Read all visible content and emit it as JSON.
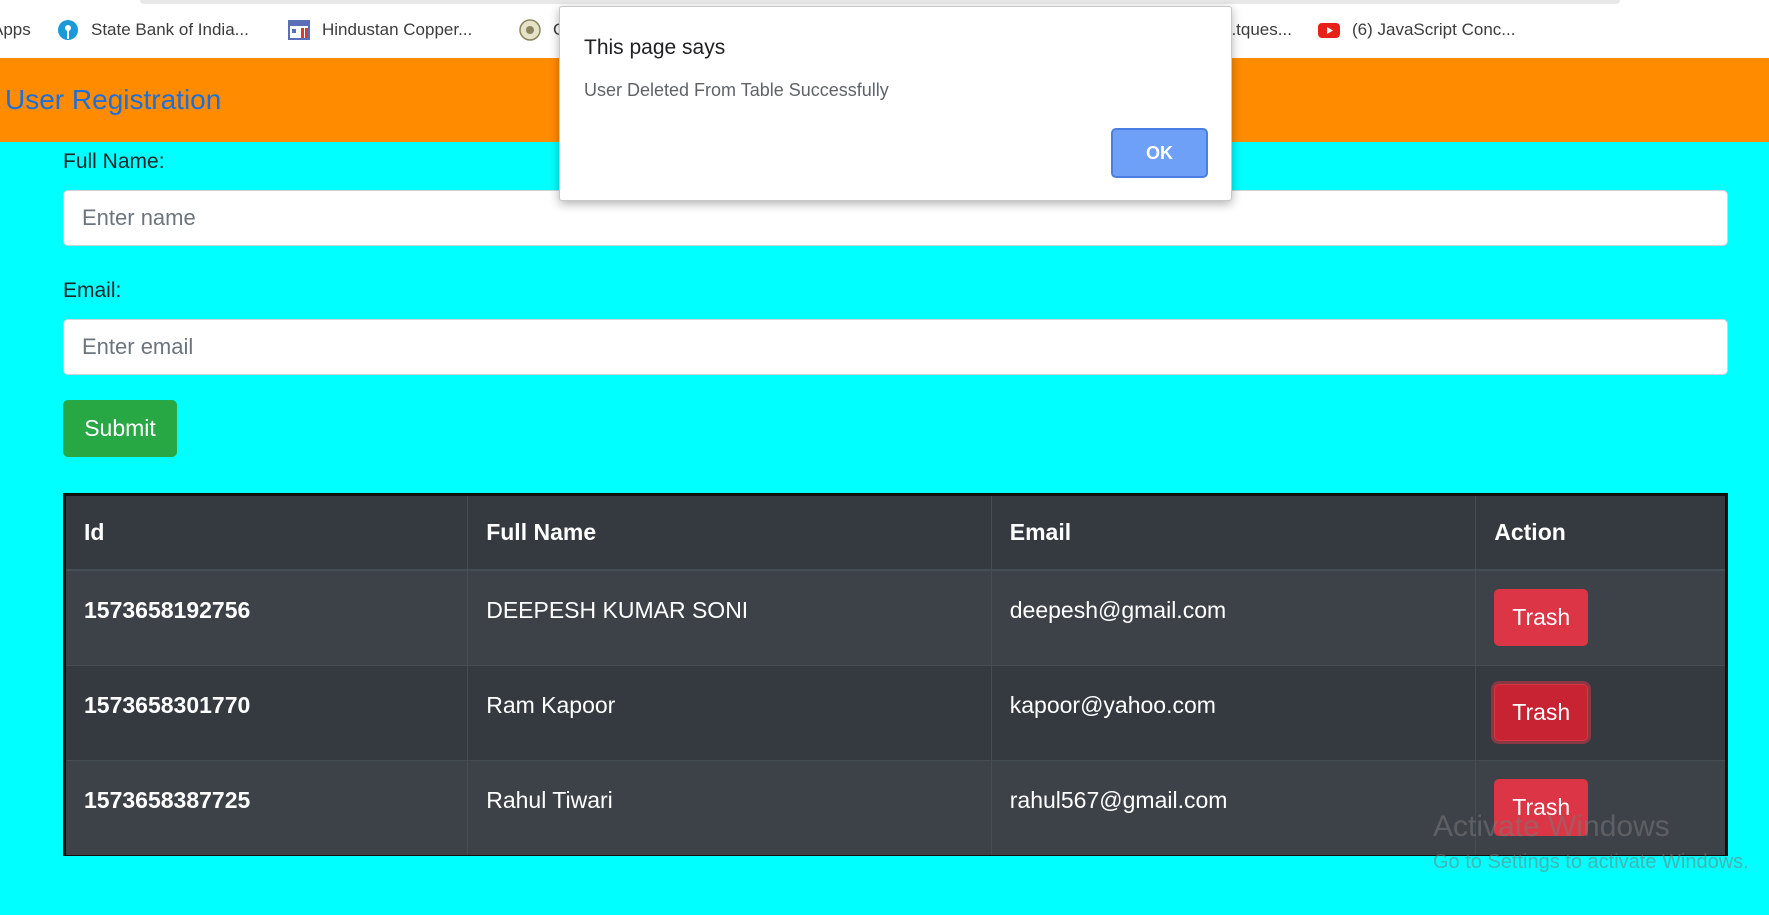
{
  "bookmarks": [
    {
      "label": "Apps",
      "icon": "apps-icon"
    },
    {
      "label": "State Bank of India...",
      "icon": "sbi-icon"
    },
    {
      "label": "Hindustan Copper...",
      "icon": "hindustan-copper-icon"
    },
    {
      "label": "G",
      "icon": "emblem-icon"
    },
    {
      "label": "...tques...",
      "icon": ""
    },
    {
      "label": "(6) JavaScript Conc...",
      "icon": "youtube-icon"
    }
  ],
  "header": {
    "title": "User Registration"
  },
  "form": {
    "name_label": "Full Name:",
    "name_placeholder": "Enter name",
    "email_label": "Email:",
    "email_placeholder": "Enter email",
    "submit_label": "Submit"
  },
  "table": {
    "headers": [
      "Id",
      "Full Name",
      "Email",
      "Action"
    ],
    "rows": [
      {
        "id": "1573658192756",
        "name": "DEEPESH KUMAR SONI",
        "email": "deepesh@gmail.com",
        "action": "Trash"
      },
      {
        "id": "1573658301770",
        "name": "Ram Kapoor",
        "email": "kapoor@yahoo.com",
        "action": "Trash"
      },
      {
        "id": "1573658387725",
        "name": "Rahul Tiwari",
        "email": "rahul567@gmail.com",
        "action": "Trash"
      }
    ]
  },
  "dialog": {
    "title": "This page says",
    "message": "User Deleted From Table Successfully",
    "ok_label": "OK"
  },
  "watermark": {
    "line1": "Activate Windows",
    "line2": "Go to Settings to activate Windows."
  },
  "colors": {
    "page_bg": "#00ffff",
    "header_bg": "#ff8c00",
    "header_title": "#1e6fd9",
    "submit": "#28a745",
    "trash": "#dc3545",
    "table_dark": "#343a40"
  }
}
